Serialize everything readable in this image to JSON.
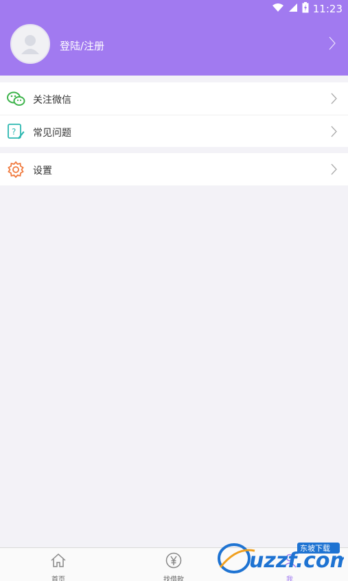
{
  "status": {
    "time": "11:23"
  },
  "profile": {
    "login_label": "登陆/注册"
  },
  "menu_group1": [
    {
      "label": "关注微信",
      "icon": "wechat-icon"
    },
    {
      "label": "常见问题",
      "icon": "faq-icon"
    }
  ],
  "menu_group2": [
    {
      "label": "设置",
      "icon": "settings-gear-icon"
    }
  ],
  "tabs": [
    {
      "label": "首页",
      "icon": "home-icon"
    },
    {
      "label": "找借款",
      "icon": "yen-icon"
    },
    {
      "label": "我",
      "icon": "user-icon"
    }
  ],
  "watermark": {
    "brand": "uzzf.com",
    "tag": "东坡下载"
  },
  "colors": {
    "accent": "#a17af0",
    "wechat_green": "#3cb34a",
    "faq_teal": "#2bb7b0",
    "settings_orange": "#f07a3e"
  }
}
